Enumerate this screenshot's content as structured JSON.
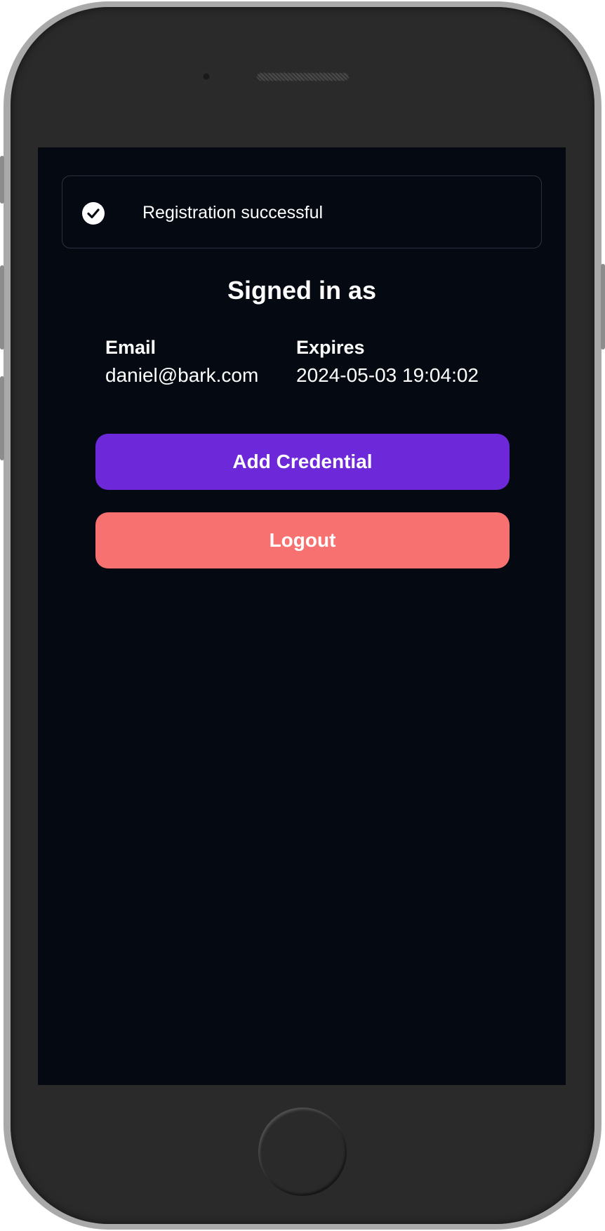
{
  "toast": {
    "icon": "check-circle-icon",
    "message": "Registration successful"
  },
  "session": {
    "title": "Signed in as",
    "email_label": "Email",
    "email_value": "daniel@bark.com",
    "expires_label": "Expires",
    "expires_value": "2024-05-03 19:04:02"
  },
  "actions": {
    "add_credential_label": "Add Credential",
    "logout_label": "Logout"
  },
  "colors": {
    "screen_bg": "#050a12",
    "primary": "#6d28d9",
    "danger": "#f87171"
  }
}
